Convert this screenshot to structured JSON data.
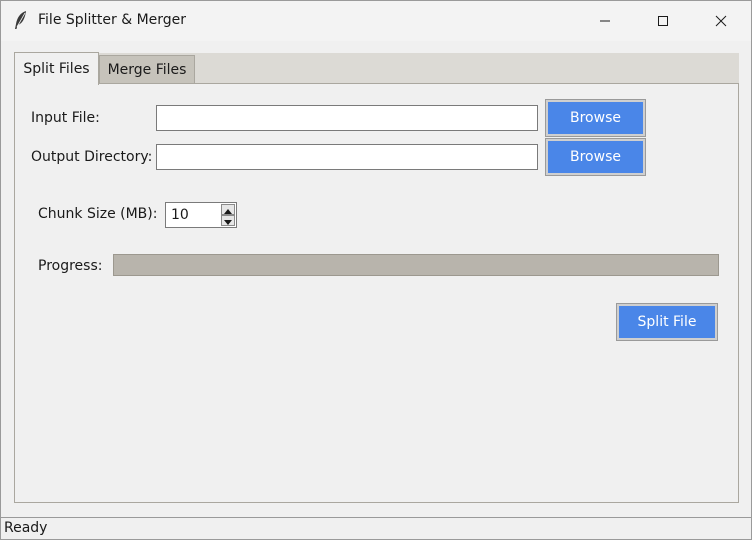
{
  "window": {
    "title": "File Splitter & Merger"
  },
  "tabs": [
    {
      "label": "Split Files",
      "active": true
    },
    {
      "label": "Merge Files",
      "active": false
    }
  ],
  "split": {
    "input_label": "Input File:",
    "input_value": "",
    "output_label": "Output Directory:",
    "output_value": "",
    "browse_label": "Browse",
    "chunk_label": "Chunk Size (MB):",
    "chunk_value": "10",
    "progress_label": "Progress:",
    "progress_value": 0,
    "split_button_label": "Split File"
  },
  "status": {
    "text": "Ready"
  },
  "colors": {
    "accent": "#4a86e8",
    "progress_trough": "#b8b4ac",
    "tab_strip": "#dcdad5"
  },
  "icons": {
    "app": "feather-icon",
    "minimize": "minimize-icon",
    "maximize": "maximize-icon",
    "close": "close-icon"
  }
}
